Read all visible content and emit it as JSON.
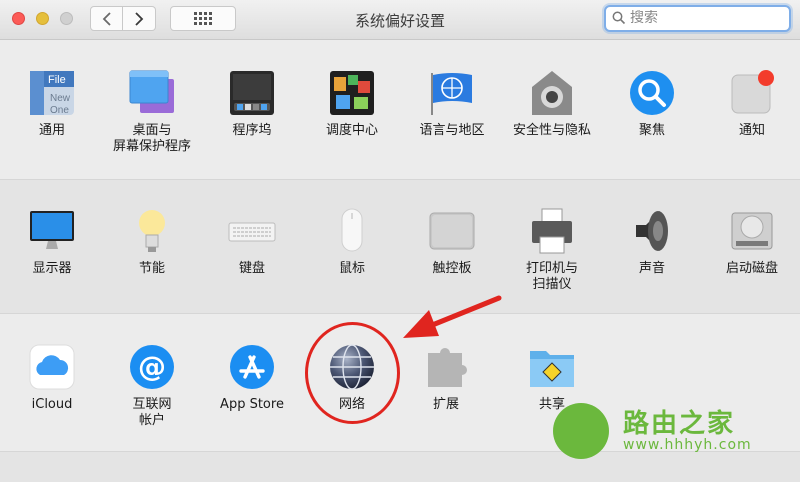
{
  "window": {
    "title": "系统偏好设置"
  },
  "search": {
    "placeholder": "搜索"
  },
  "row1": [
    {
      "label": "通用",
      "icon": "general-icon",
      "file_text": "File",
      "new_text": "New",
      "one_text": "One"
    },
    {
      "label": "桌面与\n屏幕保护程序",
      "icon": "desktop-screensaver-icon"
    },
    {
      "label": "程序坞",
      "icon": "dock-icon"
    },
    {
      "label": "调度中心",
      "icon": "mission-control-icon"
    },
    {
      "label": "语言与地区",
      "icon": "language-region-icon"
    },
    {
      "label": "安全性与隐私",
      "icon": "security-privacy-icon"
    },
    {
      "label": "聚焦",
      "icon": "spotlight-icon"
    },
    {
      "label": "通知",
      "icon": "notifications-icon"
    }
  ],
  "row2": [
    {
      "label": "显示器",
      "icon": "displays-icon"
    },
    {
      "label": "节能",
      "icon": "energy-saver-icon"
    },
    {
      "label": "键盘",
      "icon": "keyboard-icon"
    },
    {
      "label": "鼠标",
      "icon": "mouse-icon"
    },
    {
      "label": "触控板",
      "icon": "trackpad-icon"
    },
    {
      "label": "打印机与\n扫描仪",
      "icon": "printers-scanners-icon"
    },
    {
      "label": "声音",
      "icon": "sound-icon"
    },
    {
      "label": "启动磁盘",
      "icon": "startup-disk-icon"
    }
  ],
  "row3": [
    {
      "label": "iCloud",
      "icon": "icloud-icon"
    },
    {
      "label": "互联网\n帐户",
      "icon": "internet-accounts-icon"
    },
    {
      "label": "App Store",
      "icon": "app-store-icon"
    },
    {
      "label": "网络",
      "icon": "network-icon"
    },
    {
      "label": "扩展",
      "icon": "extensions-icon"
    },
    {
      "label": "共享",
      "icon": "sharing-icon"
    }
  ],
  "watermark": {
    "title": "路由之家",
    "url": "www.hhhyh.com"
  },
  "colors": {
    "annotation": "#e0251f",
    "watermark": "#6bb83d",
    "search_focus": "#7faee8"
  }
}
